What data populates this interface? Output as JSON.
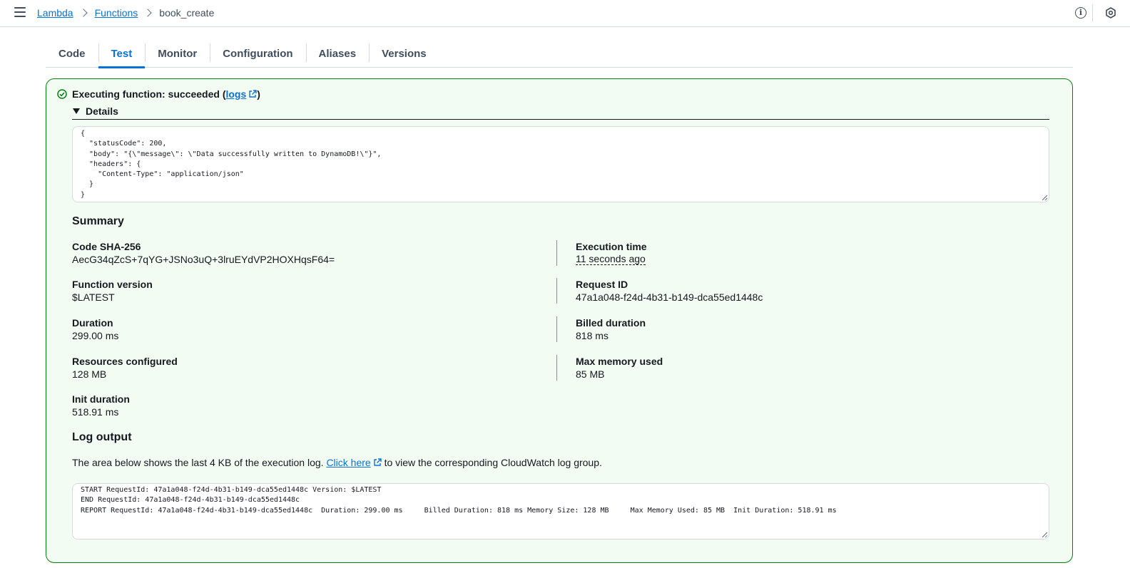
{
  "breadcrumb": {
    "items": [
      "Lambda",
      "Functions"
    ],
    "current": "book_create"
  },
  "tabs": [
    {
      "label": "Code",
      "active": false
    },
    {
      "label": "Test",
      "active": true
    },
    {
      "label": "Monitor",
      "active": false
    },
    {
      "label": "Configuration",
      "active": false
    },
    {
      "label": "Aliases",
      "active": false
    },
    {
      "label": "Versions",
      "active": false
    }
  ],
  "result": {
    "status_prefix": "Executing function: succeeded (",
    "logs_label": "logs",
    "status_suffix": ")",
    "details_label": "Details",
    "response_json": "{\n  \"statusCode\": 200,\n  \"body\": \"{\\\"message\\\": \\\"Data successfully written to DynamoDB!\\\"}\",\n  \"headers\": {\n    \"Content-Type\": \"application/json\"\n  }\n}"
  },
  "summary": {
    "heading": "Summary",
    "left": [
      {
        "label": "Code SHA-256",
        "value": "AecG34qZcS+7qYG+JSNo3uQ+3lruEYdVP2HOXHqsF64="
      },
      {
        "label": "Function version",
        "value": "$LATEST"
      },
      {
        "label": "Duration",
        "value": "299.00 ms"
      },
      {
        "label": "Resources configured",
        "value": "128 MB"
      },
      {
        "label": "Init duration",
        "value": "518.91 ms"
      }
    ],
    "right": [
      {
        "label": "Execution time",
        "value": "11 seconds ago"
      },
      {
        "label": "Request ID",
        "value": "47a1a048-f24d-4b31-b149-dca55ed1448c"
      },
      {
        "label": "Billed duration",
        "value": "818 ms"
      },
      {
        "label": "Max memory used",
        "value": "85 MB"
      }
    ]
  },
  "log_output": {
    "heading": "Log output",
    "desc_before": "The area below shows the last 4 KB of the execution log. ",
    "link_label": "Click here",
    "desc_after": " to view the corresponding CloudWatch log group.",
    "text": "START RequestId: 47a1a048-f24d-4b31-b149-dca55ed1448c Version: $LATEST\nEND RequestId: 47a1a048-f24d-4b31-b149-dca55ed1448c\nREPORT RequestId: 47a1a048-f24d-4b31-b149-dca55ed1448c\tDuration: 299.00 ms\tBilled Duration: 818 ms\tMemory Size: 128 MB\tMax Memory Used: 85 MB\tInit Duration: 518.91 ms"
  },
  "icons": {
    "menu": "hamburger-icon",
    "info": "info-icon",
    "settings": "settings-icon",
    "success": "check-circle-icon",
    "external": "external-link-icon"
  },
  "colors": {
    "link": "#0972d3",
    "success_border": "#037f0c",
    "success_bg": "#f2fcf3",
    "text": "#16191f"
  }
}
